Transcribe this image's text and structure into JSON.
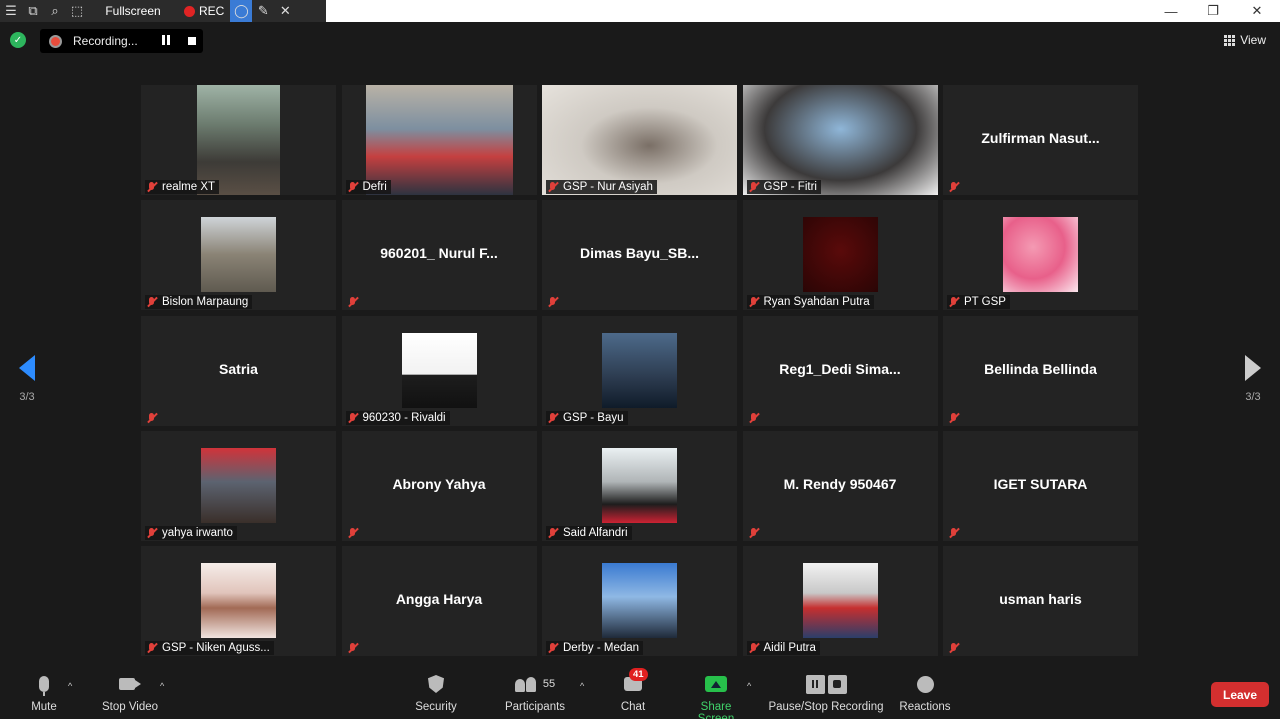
{
  "recorder_toolbar": {
    "fullscreen_label": "Fullscreen",
    "rec_label": "REC"
  },
  "recording_status": {
    "label": "Recording..."
  },
  "view": {
    "label": "View"
  },
  "pagination": {
    "left": "3/3",
    "right": "3/3"
  },
  "tiles": [
    {
      "name": "realme XT",
      "display": "",
      "media": "photo"
    },
    {
      "name": "Defri",
      "display": "",
      "media": "photo"
    },
    {
      "name": "GSP - Nur Asiyah",
      "display": "",
      "media": "photo"
    },
    {
      "name": "GSP - Fitri",
      "display": "",
      "media": "photo"
    },
    {
      "name": "",
      "display": "Zulfirman  Nasut...",
      "media": "none"
    },
    {
      "name": "Bislon Marpaung",
      "display": "",
      "media": "thumb"
    },
    {
      "name": "",
      "display": "960201_ Nurul F...",
      "media": "none"
    },
    {
      "name": "",
      "display": "Dimas  Bayu_SB...",
      "media": "none"
    },
    {
      "name": "Ryan Syahdan Putra",
      "display": "",
      "media": "thumb"
    },
    {
      "name": "PT GSP",
      "display": "",
      "media": "thumb"
    },
    {
      "name": "",
      "display": "Satria",
      "media": "none"
    },
    {
      "name": "960230 - Rivaldi",
      "display": "",
      "media": "thumb"
    },
    {
      "name": "GSP - Bayu",
      "display": "",
      "media": "thumb"
    },
    {
      "name": "",
      "display": "Reg1_Dedi  Sima...",
      "media": "none"
    },
    {
      "name": "",
      "display": "Bellinda Bellinda",
      "media": "none"
    },
    {
      "name": "yahya irwanto",
      "display": "",
      "media": "thumb"
    },
    {
      "name": "",
      "display": "Abrony Yahya",
      "media": "none"
    },
    {
      "name": "Said Alfandri",
      "display": "",
      "media": "thumb"
    },
    {
      "name": "",
      "display": "M. Rendy 950467",
      "media": "none"
    },
    {
      "name": "",
      "display": "IGET SUTARA",
      "media": "none"
    },
    {
      "name": "GSP - Niken Aguss...",
      "display": "",
      "media": "thumb"
    },
    {
      "name": "",
      "display": "Angga Harya",
      "media": "none"
    },
    {
      "name": "Derby - Medan",
      "display": "",
      "media": "thumb"
    },
    {
      "name": "Aidil Putra",
      "display": "",
      "media": "thumb"
    },
    {
      "name": "",
      "display": "usman haris",
      "media": "none"
    }
  ],
  "controls": {
    "mute": "Mute",
    "stop_video": "Stop Video",
    "security": "Security",
    "participants": "Participants",
    "participants_count": "55",
    "chat": "Chat",
    "chat_badge": "41",
    "share_screen": "Share Screen",
    "pause_stop_recording": "Pause/Stop Recording",
    "reactions": "Reactions",
    "leave": "Leave"
  },
  "colors": {
    "accent": "#2d8cff",
    "leave": "#d32f2f",
    "share": "#27c04b",
    "muted": "#e0403a"
  }
}
